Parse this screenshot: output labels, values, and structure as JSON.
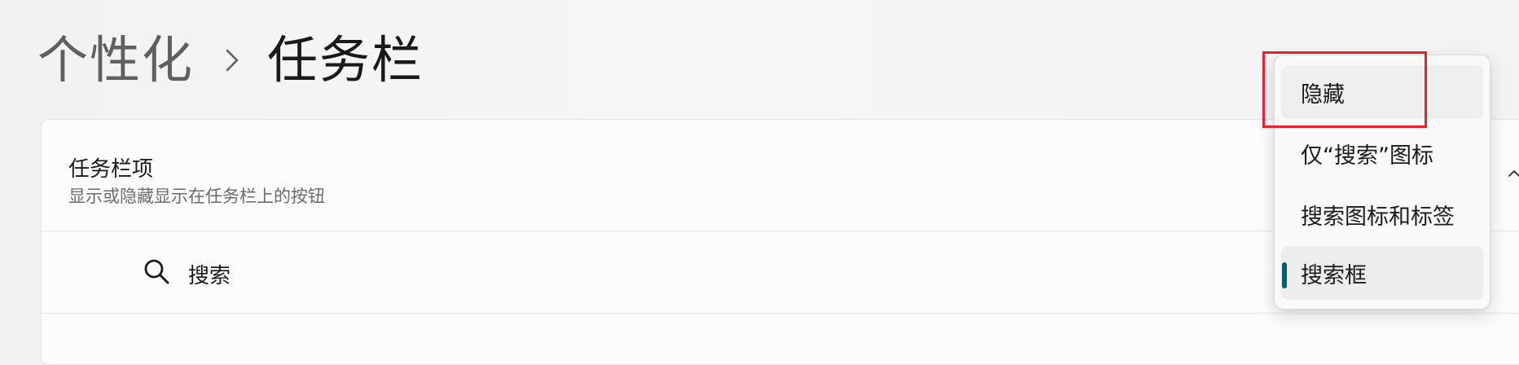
{
  "breadcrumb": {
    "parent": "个性化",
    "current": "任务栏"
  },
  "taskbar_items": {
    "title": "任务栏项",
    "subtitle": "显示或隐藏显示在任务栏上的按钮"
  },
  "search_row": {
    "label": "搜索",
    "icon": "search-icon"
  },
  "search_menu": {
    "options": [
      {
        "label": "隐藏"
      },
      {
        "label": "仅“搜索”图标"
      },
      {
        "label": "搜索图标和标签"
      },
      {
        "label": "搜索框"
      }
    ],
    "selected_index": 3
  },
  "colors": {
    "accent": "#00606b",
    "highlight": "#e5202f"
  }
}
